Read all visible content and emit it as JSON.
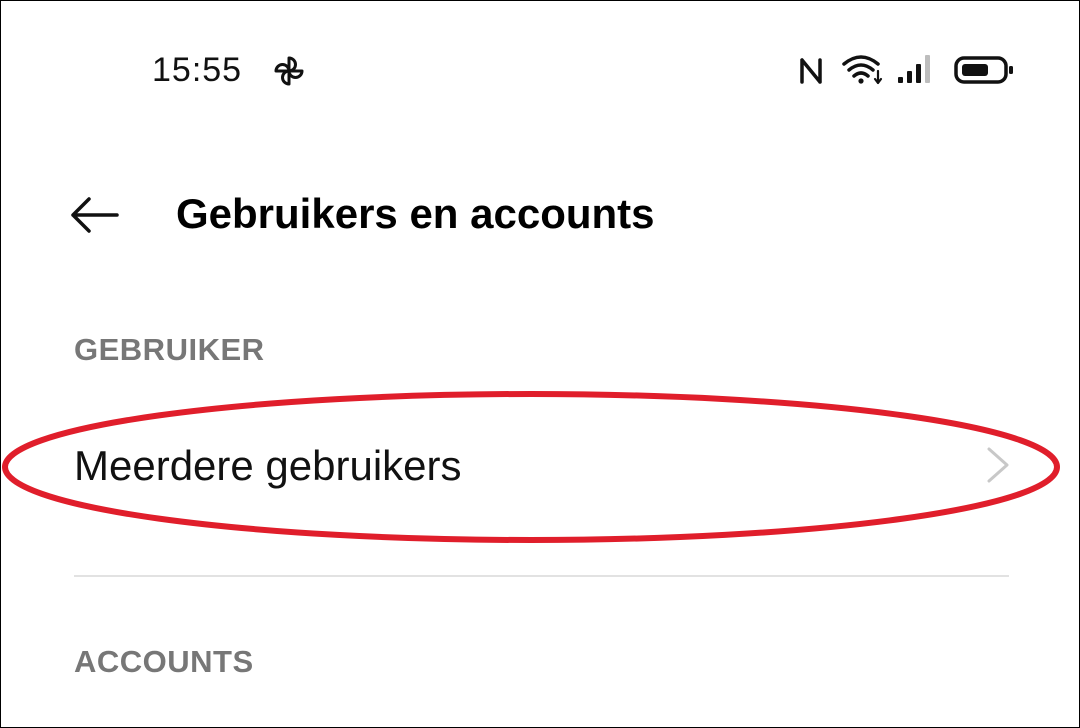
{
  "status_bar": {
    "time": "15:55",
    "icons": [
      "pinwheel-icon",
      "nfc-icon",
      "wifi-icon",
      "signal-icon",
      "battery-icon"
    ]
  },
  "header": {
    "title": "Gebruikers en accounts",
    "back_icon": "arrow-left-icon"
  },
  "sections": {
    "user": {
      "header": "GEBRUIKER",
      "items": [
        {
          "label": "Meerdere gebruikers",
          "icon": "chevron-right-icon"
        }
      ]
    },
    "accounts": {
      "header": "ACCOUNTS"
    }
  },
  "colors": {
    "background": "#ffffff",
    "section_header": "#777777",
    "divider": "#e2e2e2",
    "highlight": "#e01e2b",
    "chevron": "#c8c8c8"
  }
}
